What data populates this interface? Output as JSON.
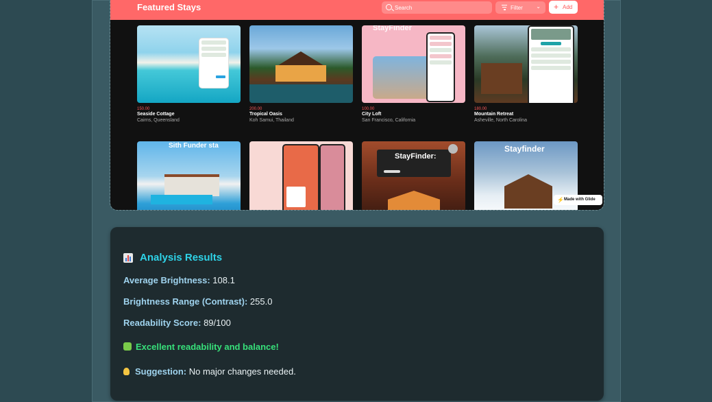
{
  "app": {
    "header_title": "Featured Stays",
    "search_placeholder": "Search",
    "filter_label": "Filter",
    "add_label": "Add",
    "badge": "Made with Glide"
  },
  "listings": [
    {
      "price": "150.00",
      "title": "Seaside Cottage",
      "location": "Cairns, Queensland"
    },
    {
      "price": "200.00",
      "title": "Tropical Oasis",
      "location": "Koh Samui, Thailand"
    },
    {
      "price": "100.00",
      "title": "City Loft",
      "location": "San Francisco, California"
    },
    {
      "price": "180.00",
      "title": "Mountain Retreat",
      "location": "Asheville, North Carolina"
    }
  ],
  "image_overlays": {
    "city_loft": "StayFinder",
    "beach": "Sith Funder sta",
    "canyon": "StayFinder:",
    "snow": "Stayfinder"
  },
  "analysis": {
    "title": "Analysis Results",
    "brightness_label": "Average Brightness:",
    "brightness_value": "108.1",
    "contrast_label": "Brightness Range (Contrast):",
    "contrast_value": "255.0",
    "readability_label": "Readability Score:",
    "readability_value": "89/100",
    "verdict": "Excellent readability and balance!",
    "suggestion_label": "Suggestion:",
    "suggestion_value": "No major changes needed."
  },
  "colors": {
    "accent": "#ff6868",
    "title": "#2ed3e8",
    "verdict": "#37e07a"
  }
}
